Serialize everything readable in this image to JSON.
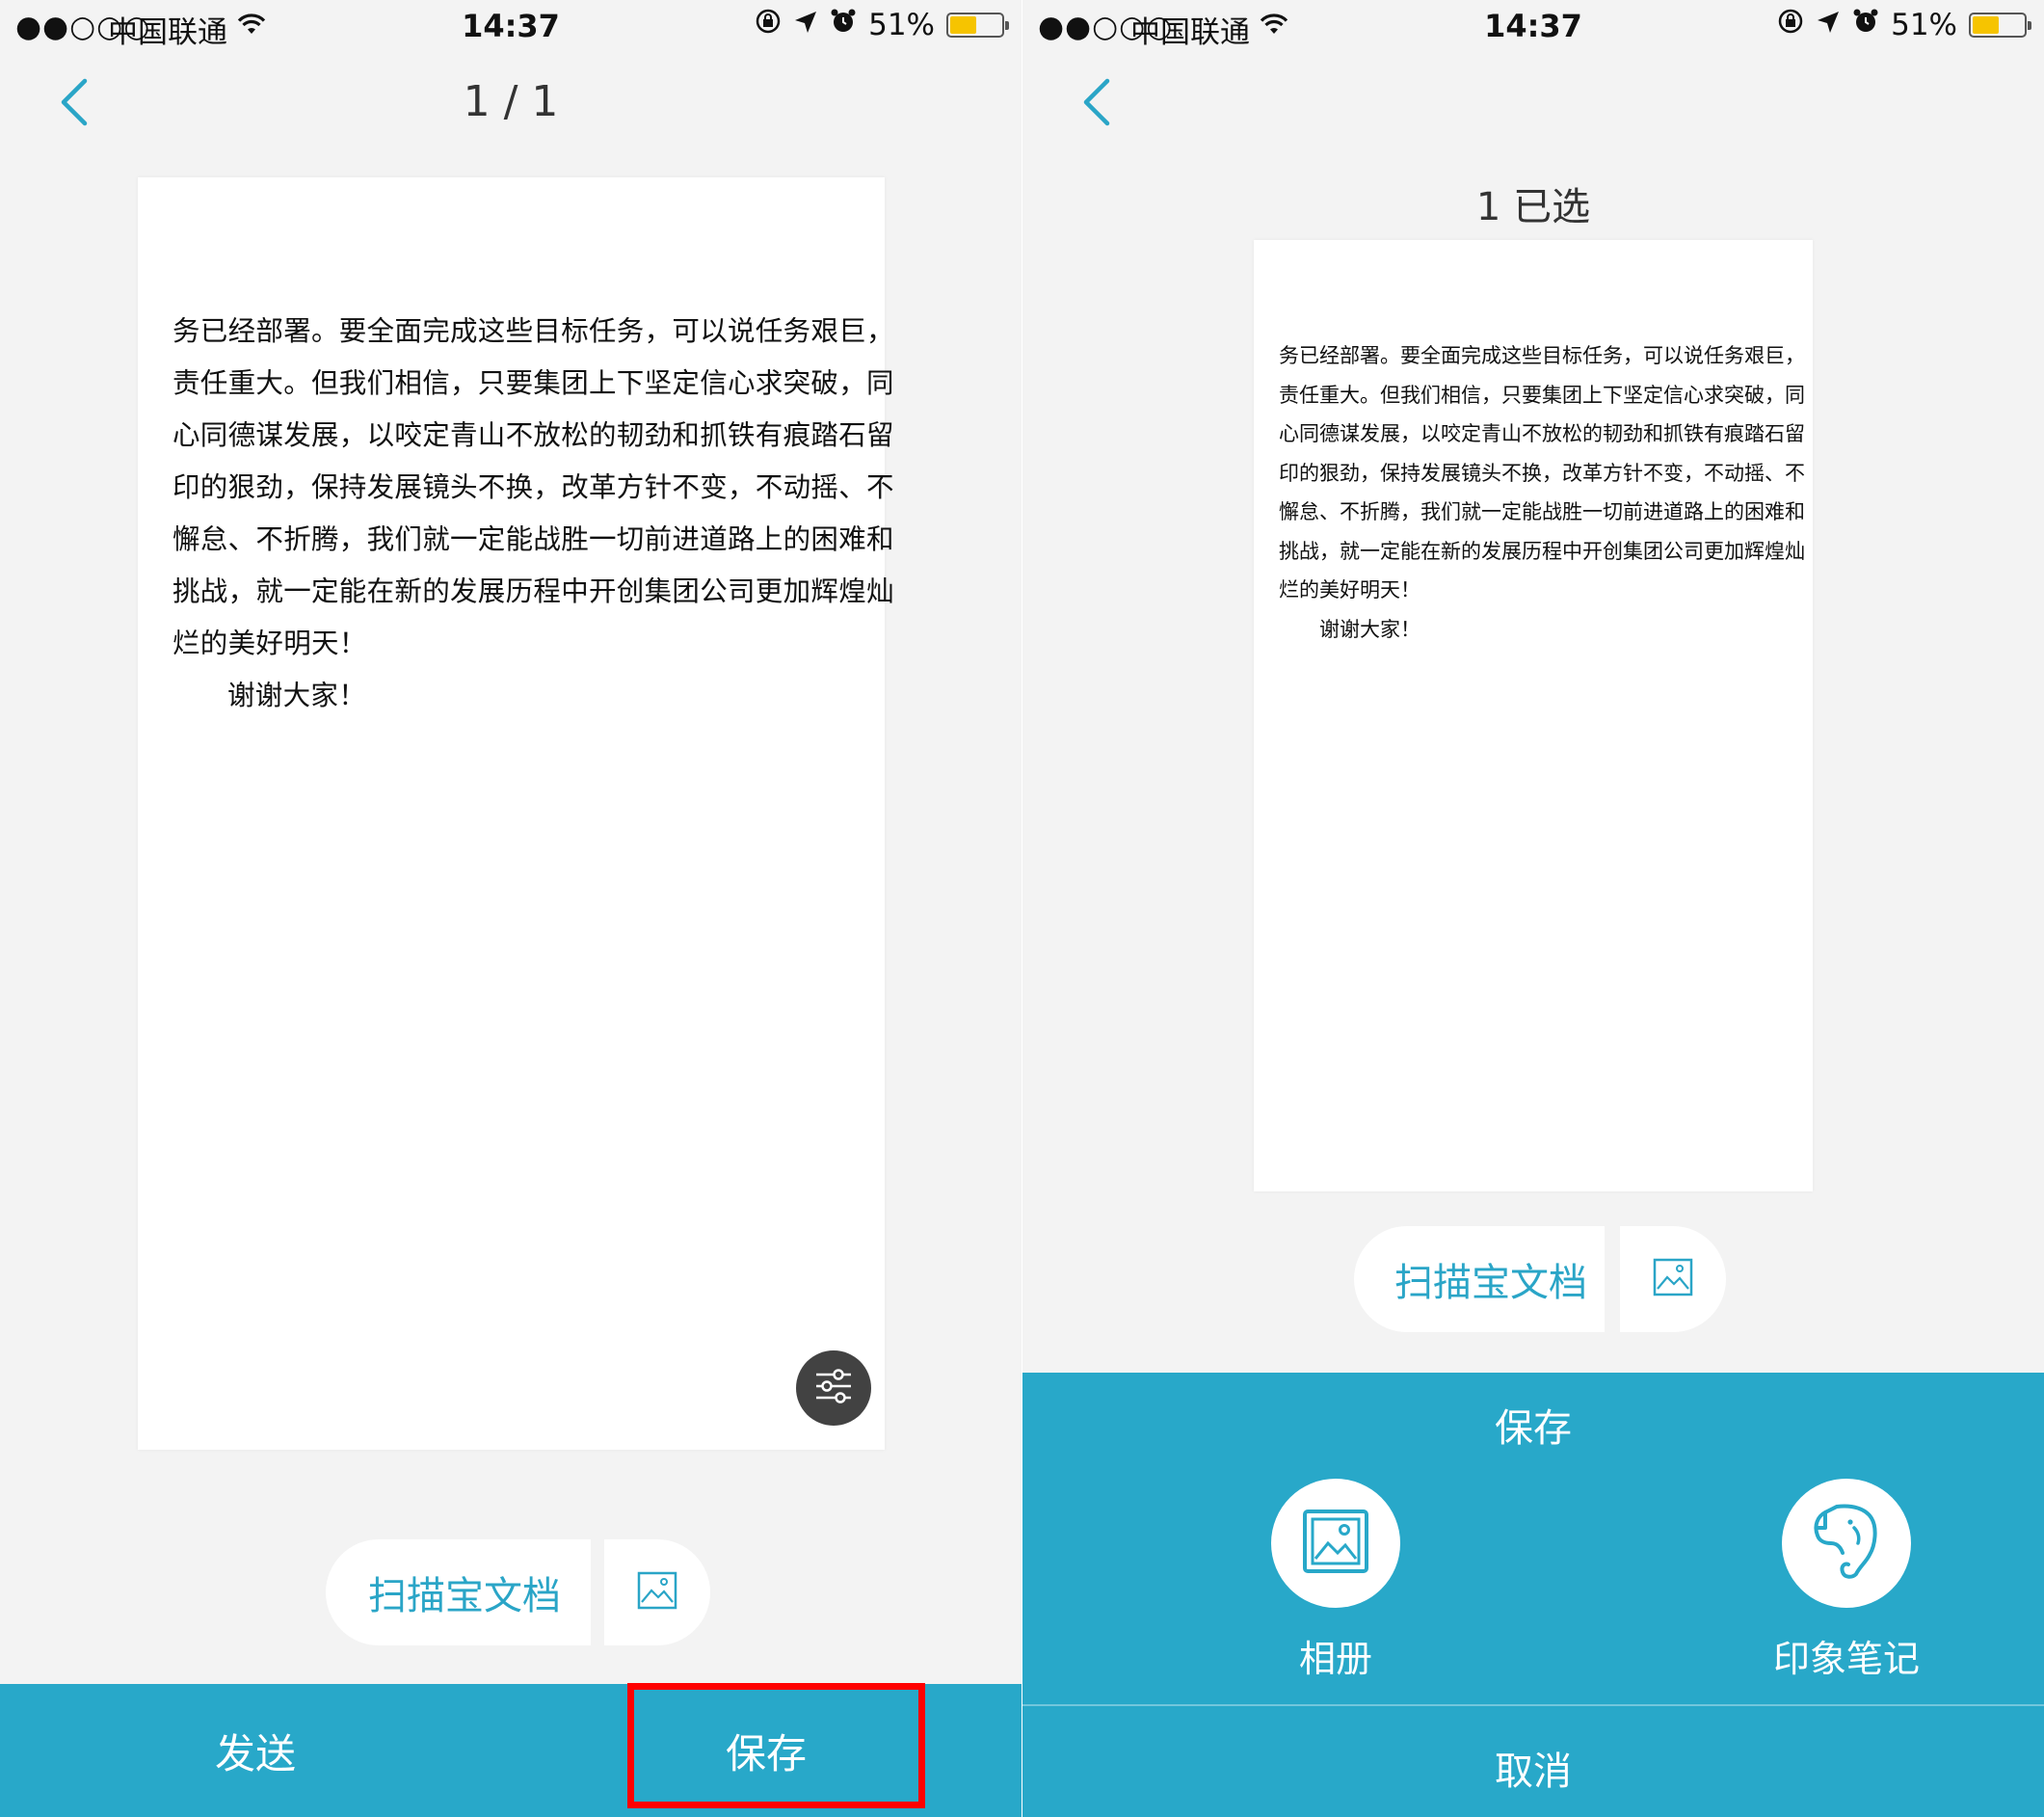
{
  "status_bar": {
    "signal": "●●○○○",
    "carrier": "中国联通",
    "time": "14:37",
    "battery": "51%",
    "battery_level": 0.51
  },
  "left_screen": {
    "page_counter": "1 / 1",
    "watermark_text": "扫描宝文档",
    "bottom_bar": {
      "send_label": "发送",
      "save_label": "保存"
    }
  },
  "right_screen": {
    "selected_label": "1 已选",
    "watermark_text": "扫描宝文档",
    "sheet": {
      "title": "保存",
      "options": [
        {
          "label": "相册",
          "icon": "photo-album-icon"
        },
        {
          "label": "印象笔记",
          "icon": "evernote-elephant-icon"
        }
      ],
      "cancel_label": "取消"
    }
  },
  "document": {
    "lines_left": [
      "务已经部署。要全面完成这些目标任务，可以说任务艰巨，",
      "责任重大。但我们相信，只要集团上下坚定信心求突破，同",
      "心同德谋发展，以咬定青山不放松的韧劲和抓铁有痕踏石留",
      "印的狠劲，保持发展镜头不换，改革方针不变，不动摇、不",
      "懈怠、不折腾，我们就一定能战胜一切前进道路上的困难和",
      "挑战，就一定能在新的发展历程中开创集团公司更加辉煌灿",
      "烂的美好明天！",
      "谢谢大家！"
    ],
    "lines_right": [
      "务已经部署。要全面完成这些目标任务，可以说任务艰巨，",
      "责任重大。但我们相信，只要集团上下坚定信心求突破，同",
      "心同德谋发展，以咬定青山不放松的韧劲和抓铁有痕踏石留",
      "印的狠劲，保持发展镜头不换，改革方针不变，不动摇、不",
      "懈怠、不折腾，我们就一定能战胜一切前进道路上的困难和",
      "挑战，就一定能在新的发展历程中开创集团公司更加辉煌灿",
      "烂的美好明天！",
      "谢谢大家！"
    ]
  },
  "colors": {
    "accent": "#28a8c9",
    "watermark_text": "#2aa5c7",
    "highlight_box": "#ff0000",
    "background": "#f3f3f3"
  },
  "icons": {
    "back": "chevron-left-icon",
    "wifi": "wifi-icon",
    "filter": "sliders-icon",
    "image": "image-icon"
  }
}
